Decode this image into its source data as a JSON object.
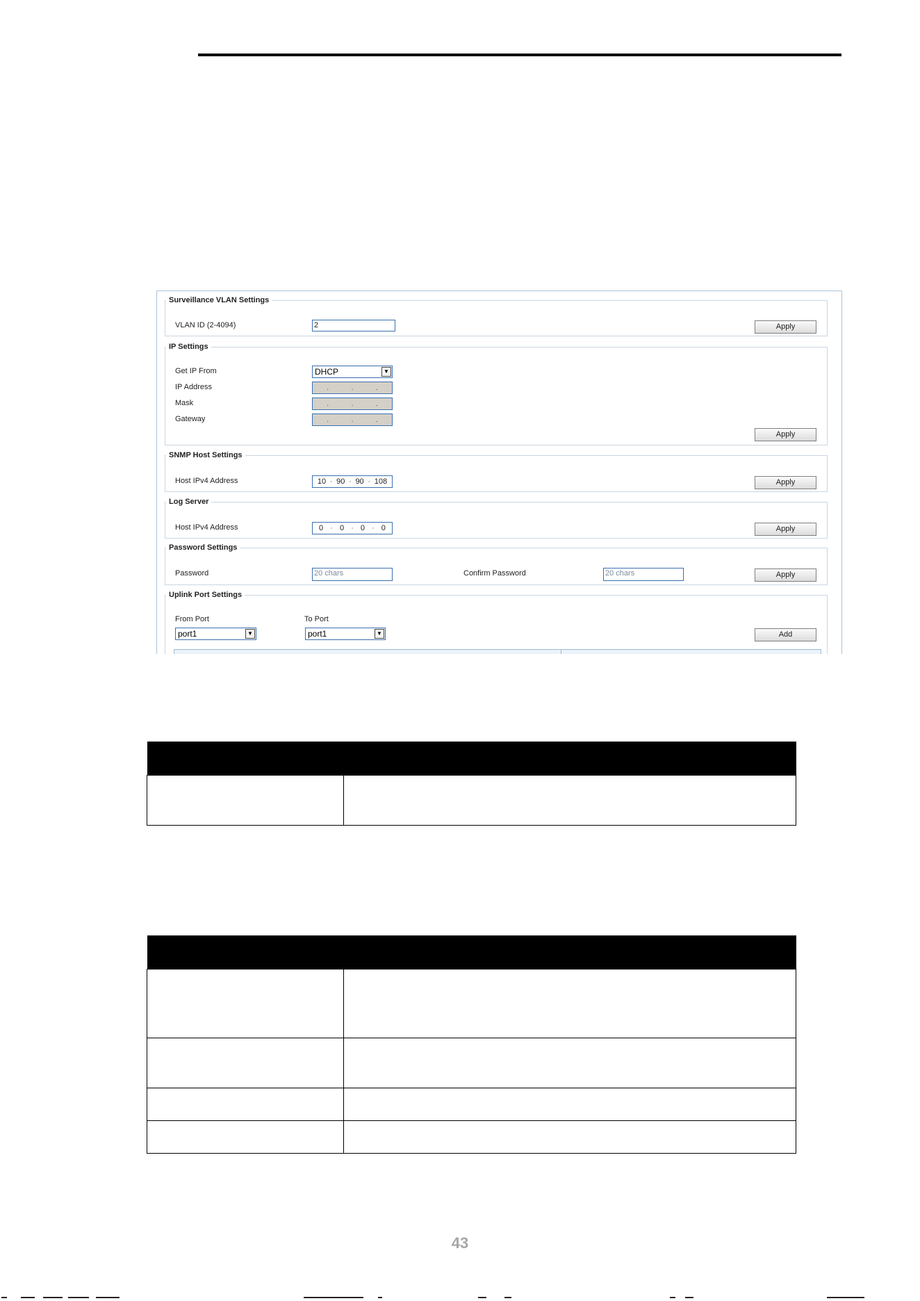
{
  "screenshot": {
    "surveillance_vlan": {
      "legend": "Surveillance VLAN Settings",
      "vlan_label": "VLAN ID (2-4094)",
      "vlan_value": "2",
      "apply": "Apply"
    },
    "ip_settings": {
      "legend": "IP Settings",
      "get_ip_label": "Get IP From",
      "get_ip_value": "DHCP",
      "ip_label": "IP Address",
      "mask_label": "Mask",
      "gateway_label": "Gateway",
      "dot": ".",
      "apply": "Apply"
    },
    "snmp_host": {
      "legend": "SNMP Host Settings",
      "host_label": "Host IPv4 Address",
      "octets": [
        "10",
        "90",
        "90",
        "108"
      ],
      "apply": "Apply"
    },
    "log_server": {
      "legend": "Log Server",
      "host_label": "Host IPv4 Address",
      "octets": [
        "0",
        "0",
        "0",
        "0"
      ],
      "apply": "Apply"
    },
    "password": {
      "legend": "Password Settings",
      "password_label": "Password",
      "password_placeholder": "20 chars",
      "confirm_label": "Confirm Password",
      "confirm_placeholder": "20 chars",
      "apply": "Apply"
    },
    "uplink": {
      "legend": "Uplink Port Settings",
      "from_label": "From Port",
      "from_value": "port1",
      "to_label": "To Port",
      "to_value": "port1",
      "add": "Add"
    }
  },
  "page_number": "43"
}
